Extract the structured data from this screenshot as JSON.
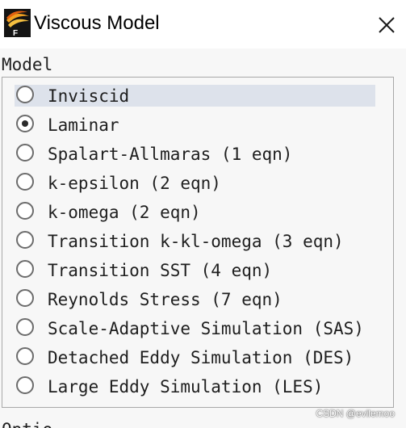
{
  "window": {
    "title": "Viscous Model",
    "icon": "fluent-logo-icon",
    "close_icon": "close-icon"
  },
  "model_section": {
    "label": "Model",
    "selected": "Laminar",
    "options": [
      {
        "label": "Inviscid",
        "checked": false,
        "highlighted": true
      },
      {
        "label": "Laminar",
        "checked": true,
        "highlighted": false
      },
      {
        "label": "Spalart-Allmaras (1 eqn)",
        "checked": false,
        "highlighted": false
      },
      {
        "label": "k-epsilon (2 eqn)",
        "checked": false,
        "highlighted": false
      },
      {
        "label": "k-omega (2 eqn)",
        "checked": false,
        "highlighted": false
      },
      {
        "label": "Transition k-kl-omega (3 eqn)",
        "checked": false,
        "highlighted": false
      },
      {
        "label": "Transition SST (4 eqn)",
        "checked": false,
        "highlighted": false
      },
      {
        "label": "Reynolds Stress (7 eqn)",
        "checked": false,
        "highlighted": false
      },
      {
        "label": "Scale-Adaptive Simulation (SAS)",
        "checked": false,
        "highlighted": false
      },
      {
        "label": "Detached Eddy Simulation (DES)",
        "checked": false,
        "highlighted": false
      },
      {
        "label": "Large Eddy Simulation (LES)",
        "checked": false,
        "highlighted": false
      }
    ]
  },
  "next_section": {
    "label": "Optio"
  },
  "watermark": "CSDN @evilemoo",
  "colors": {
    "highlight": "#dde2eb",
    "window_bg": "#f7f7f7",
    "border": "#a8a8a8"
  }
}
